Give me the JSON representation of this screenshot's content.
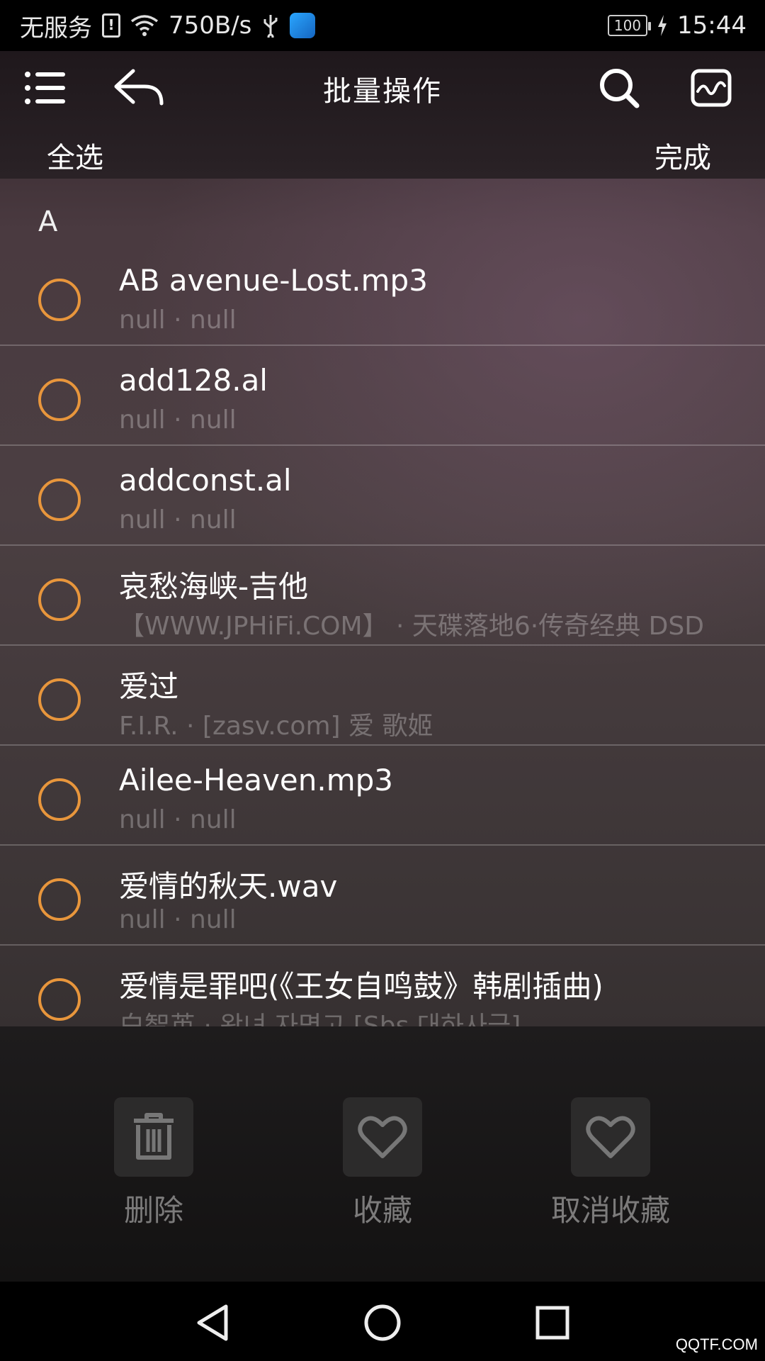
{
  "status_bar": {
    "carrier": "无服务",
    "speed": "750B/s",
    "battery": "100",
    "time": "15:44"
  },
  "header": {
    "title": "批量操作",
    "select_all": "全选",
    "done": "完成"
  },
  "list": {
    "section": "A",
    "items": [
      {
        "title": "AB avenue-Lost.mp3",
        "sub": "null · null"
      },
      {
        "title": "add128.al",
        "sub": "null · null"
      },
      {
        "title": "addconst.al",
        "sub": "null · null"
      },
      {
        "title": "哀愁海峡-吉他",
        "sub": "【WWW.JPHiFi.COM】 · 天碟落地6·传奇经典 DSD"
      },
      {
        "title": "爱过",
        "sub": "F.I.R. · [zasv.com] 爱 歌姬"
      },
      {
        "title": "Ailee-Heaven.mp3",
        "sub": "null · null"
      },
      {
        "title": "爱情的秋天.wav",
        "sub": "null · null"
      },
      {
        "title": "爱情是罪吧(《王女自鸣鼓》韩剧插曲)",
        "sub": "白智英 · 왕녀 자명고 [Sbs 대하사극]"
      }
    ]
  },
  "actions": {
    "delete": "删除",
    "favorite": "收藏",
    "unfavorite": "取消收藏"
  },
  "watermark": "QQTF.COM",
  "colors": {
    "accent": "#e8963c"
  }
}
